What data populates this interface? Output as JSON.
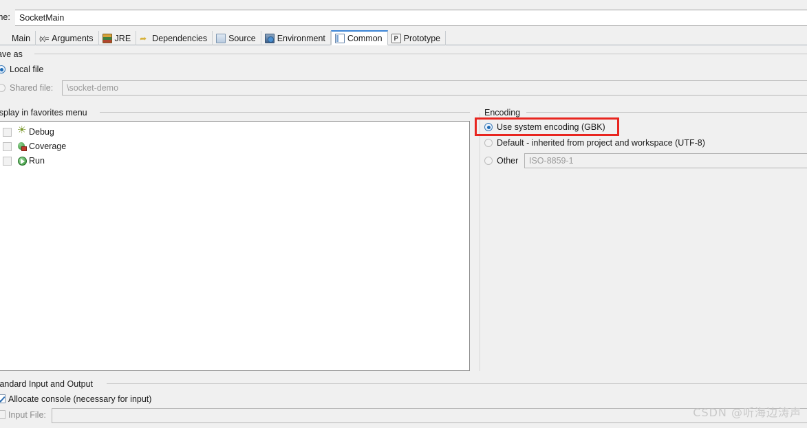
{
  "window": {
    "name_label": "me:",
    "name_value": "SocketMain"
  },
  "tabs": [
    {
      "label": "Main",
      "icon": "main-icon",
      "selected": false
    },
    {
      "label": "Arguments",
      "icon": "arguments-icon",
      "selected": false
    },
    {
      "label": "JRE",
      "icon": "jre-icon",
      "selected": false
    },
    {
      "label": "Dependencies",
      "icon": "dependencies-icon",
      "selected": false
    },
    {
      "label": "Source",
      "icon": "source-icon",
      "selected": false
    },
    {
      "label": "Environment",
      "icon": "environment-icon",
      "selected": false
    },
    {
      "label": "Common",
      "icon": "common-icon",
      "selected": true
    },
    {
      "label": "Prototype",
      "icon": "prototype-icon",
      "selected": false
    }
  ],
  "save_as": {
    "group_label": "ave as",
    "local_file": {
      "label": "Local file",
      "selected": true
    },
    "shared_file": {
      "label": "Shared file:",
      "selected": false,
      "value": "\\socket-demo"
    }
  },
  "favorites": {
    "group_label": "isplay in favorites menu",
    "items": [
      {
        "label": "Debug",
        "icon": "debug-icon",
        "checked": false
      },
      {
        "label": "Coverage",
        "icon": "coverage-icon",
        "checked": false
      },
      {
        "label": "Run",
        "icon": "run-icon",
        "checked": false
      }
    ]
  },
  "encoding": {
    "group_label": "Encoding",
    "options": [
      {
        "label": "Use system encoding (GBK)",
        "selected": true
      },
      {
        "label": "Default - inherited from project and workspace (UTF-8)",
        "selected": false
      },
      {
        "label": "Other",
        "selected": false
      }
    ],
    "other_value": "ISO-8859-1",
    "highlight_color": "#e8251f"
  },
  "standard_io": {
    "group_label": "tandard Input and Output",
    "allocate_console": {
      "label": "Allocate console (necessary for input)",
      "checked": true
    },
    "input_file": {
      "label": "Input File:",
      "checked": false,
      "value": ""
    }
  },
  "watermark": {
    "text": "CSDN @听海边涛声"
  }
}
